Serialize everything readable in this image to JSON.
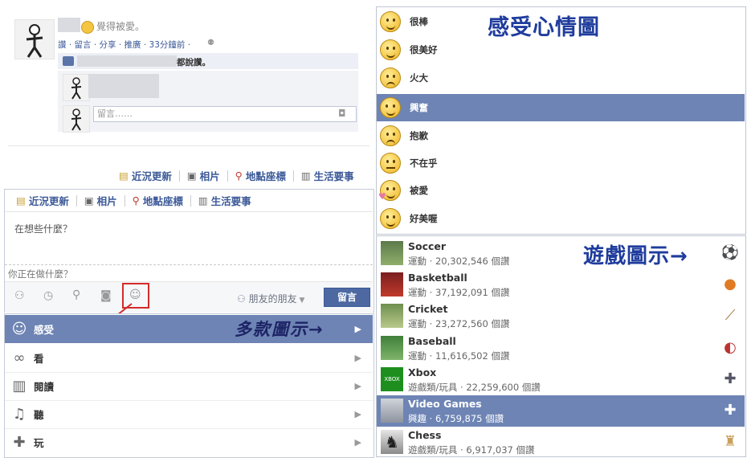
{
  "post": {
    "feeling_text": "覺得被愛。",
    "meta": "讚 · 留言 · 分享 · 推廣 · 33分鐘前 ·",
    "likes_text": "都說讚。",
    "reply_placeholder": "留言……"
  },
  "tabs_top": [
    "近況更新",
    "相片",
    "地點座標",
    "生活要事"
  ],
  "composer": {
    "tabs": [
      "近況更新",
      "相片",
      "地點座標",
      "生活要事"
    ],
    "status_placeholder": "在想些什麼？",
    "doing_placeholder": "你正在做什麼？",
    "privacy": "朋友的朋友",
    "post_button": "留言"
  },
  "menu": {
    "items": [
      {
        "label": "感受",
        "icon": "smiley-icon"
      },
      {
        "label": "看",
        "icon": "glasses-icon"
      },
      {
        "label": "閱讀",
        "icon": "book-icon"
      },
      {
        "label": "聽",
        "icon": "headphones-icon"
      },
      {
        "label": "玩",
        "icon": "gamepad-icon"
      }
    ],
    "callout": "多款圖示→"
  },
  "feelings": {
    "title": "感受心情圖",
    "items": [
      "很棒",
      "很美好",
      "火大",
      "興奮",
      "抱歉",
      "不在乎",
      "被愛",
      "好美喔"
    ]
  },
  "games": {
    "title": "遊戲圖示→",
    "items": [
      {
        "name": "Soccer",
        "sub": "運動 · 20,302,546 個讚",
        "icon": "soccer-ball-icon"
      },
      {
        "name": "Basketball",
        "sub": "運動 · 37,192,091 個讚",
        "icon": "basketball-icon"
      },
      {
        "name": "Cricket",
        "sub": "運動 · 23,272,560 個讚",
        "icon": "cricket-bat-icon"
      },
      {
        "name": "Baseball",
        "sub": "運動 · 11,616,502 個讚",
        "icon": "baseball-icon"
      },
      {
        "name": "Xbox",
        "sub": "遊戲類/玩具 · 22,259,600 個讚",
        "icon": "controller-icon"
      },
      {
        "name": "Video Games",
        "sub": "興趣 · 6,759,875 個讚",
        "icon": "controller-icon"
      },
      {
        "name": "Chess",
        "sub": "遊戲類/玩具 · 6,917,037 個讚",
        "icon": "chess-rook-icon"
      }
    ]
  },
  "colors": {
    "brand": "#3b5998",
    "highlight": "#6d84b4",
    "callout": "#1f3c9d",
    "annotation_red": "#d42b2b"
  }
}
